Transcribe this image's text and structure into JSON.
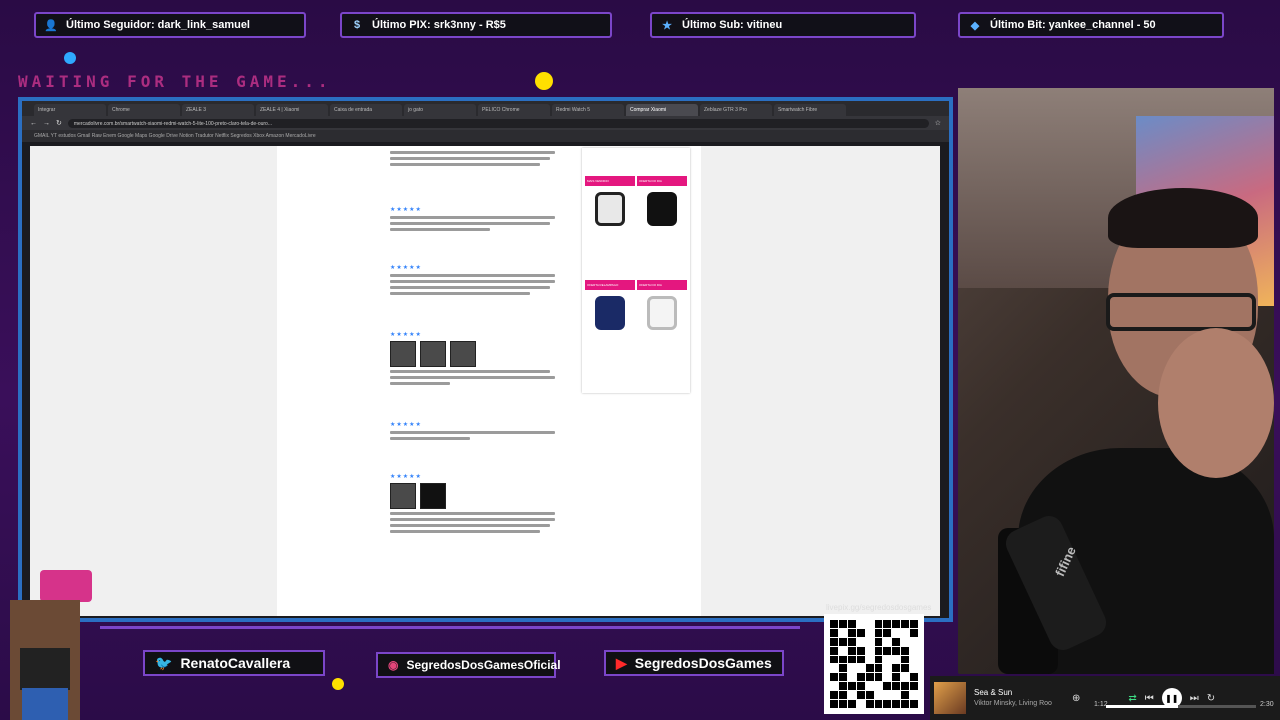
{
  "alerts": {
    "follower": "Último Seguidor: dark_link_samuel",
    "pix": "Último PIX: srk3nny - R$5",
    "sub": "Último Sub: vitineu",
    "bit": "Último Bit: yankee_channel - 50"
  },
  "overlay": {
    "waiting_text": "WAITING FOR THE GAME..."
  },
  "browser": {
    "tabs": [
      "Integrar",
      "Chrome",
      "ZEALE 3",
      "ZEALE 4 | Xiaomi",
      "Caixa de entrada",
      "jo gato",
      "PELICO Chrome",
      "Redmi Watch 5",
      "Comprar Xiaomi",
      "Zeblaze GTR 3 Pro",
      "Smartwatch Fibre"
    ],
    "url": "mercadolivre.com.br/smartwatch-xiaomi-redmi-watch-5-lite-100-preto-claro-tela-de-ouro...",
    "bookmarks": "GMAIL  YT  estudos  Gmail  Raw  Enem  Google Maps  Google Drive  Notion  Tradutor  Netflix  Segredos  Xbox  Amazon  MercadoLivre",
    "product_tags": [
      "MAIS VENDIDO",
      "OFERTA DO DIA",
      "OFERTA RELAMPAGO",
      "OFERTA DO DIA"
    ]
  },
  "social": {
    "twitter": "RenatoCavallera",
    "instagram": "SegredosDosGamesOficial",
    "youtube": "SegredosDosGames"
  },
  "qr": {
    "caption": "livepix.gg/segredosdosgames"
  },
  "player": {
    "title": "Sea & Sun",
    "artist": "Viktor Minsky, Living Roo",
    "elapsed": "1:12",
    "total": "2:30",
    "progress": 0.48
  },
  "webcam": {
    "mic_brand": "fifine"
  },
  "colors": {
    "accent_purple": "#7b46c9",
    "browser_border": "#2b6fc2",
    "waiting_pink": "#c2338a"
  }
}
